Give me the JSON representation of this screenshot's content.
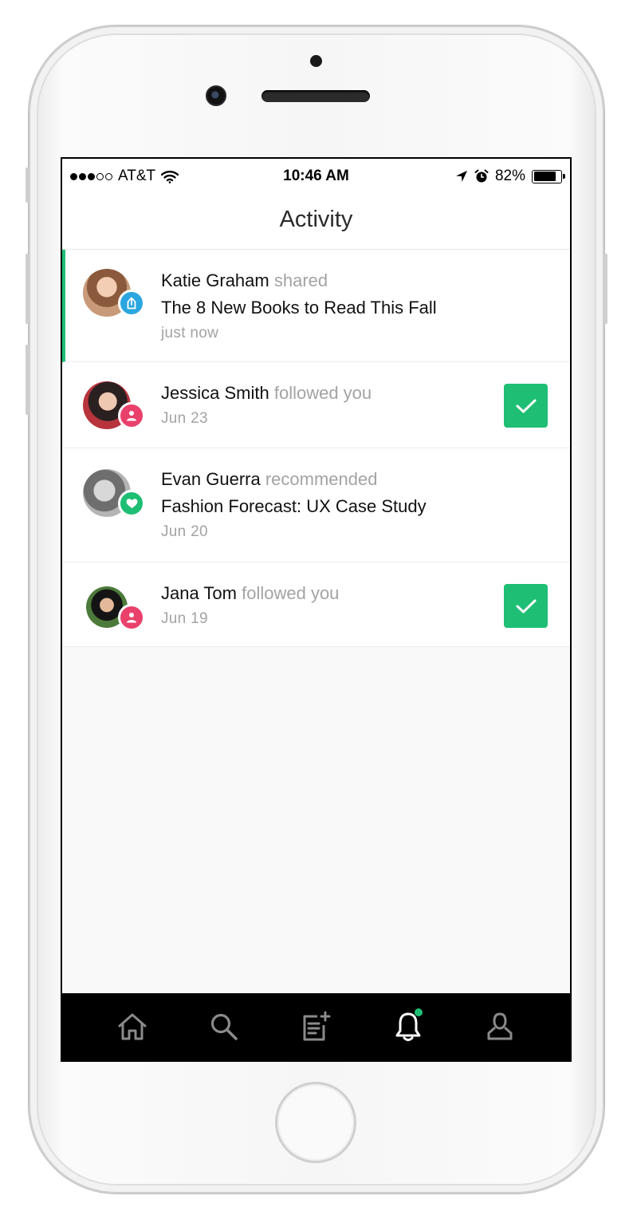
{
  "status_bar": {
    "carrier": "AT&T",
    "time": "10:46 AM",
    "battery": "82%",
    "battery_level": 0.82,
    "signal_bars": 3,
    "signal_total": 5
  },
  "header": {
    "title": "Activity"
  },
  "activity": [
    {
      "name": "Katie Graham",
      "action": "shared",
      "title": "The 8 New Books to Read This Fall",
      "time": "just now",
      "badge": "share-icon",
      "badge_color": "#2aa7e0",
      "unread": true,
      "followable": false
    },
    {
      "name": "Jessica Smith",
      "action": "followed you",
      "title": "",
      "time": "Jun 23",
      "badge": "person-icon",
      "badge_color": "#e9416b",
      "unread": false,
      "followable": true
    },
    {
      "name": "Evan Guerra",
      "action": "recommended",
      "title": "Fashion Forecast: UX Case Study",
      "time": "Jun 20",
      "badge": "heart-icon",
      "badge_color": "#1ebf75",
      "unread": false,
      "followable": false
    },
    {
      "name": "Jana Tom",
      "action": "followed you",
      "title": "",
      "time": "Jun 19",
      "badge": "person-icon",
      "badge_color": "#e9416b",
      "unread": false,
      "followable": true
    }
  ],
  "tabs": [
    {
      "name": "home-icon",
      "active": false
    },
    {
      "name": "search-icon",
      "active": false
    },
    {
      "name": "compose-icon",
      "active": false
    },
    {
      "name": "bell-icon",
      "active": true
    },
    {
      "name": "profile-icon",
      "active": false
    }
  ],
  "colors": {
    "accent": "#1ebf75",
    "share_badge": "#2aa7e0",
    "follow_badge": "#e9416b",
    "muted_text": "#a3a3a3"
  }
}
